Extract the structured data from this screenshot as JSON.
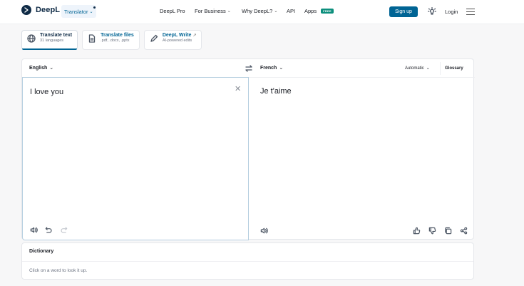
{
  "header": {
    "logo_text": "DeepL",
    "translator_label": "Translator",
    "nav": {
      "pro": "DeepL Pro",
      "business": "For Business",
      "why": "Why DeepL?",
      "api": "API",
      "apps": "Apps",
      "free_badge": "FREE"
    },
    "signup": "Sign up",
    "login": "Login"
  },
  "tabs": [
    {
      "label": "Translate text",
      "sub": "31 languages"
    },
    {
      "label": "Translate files",
      "sub": ".pdf, .docx, .pptx"
    },
    {
      "label": "DeepL Write",
      "sub": "AI-powered edits"
    }
  ],
  "translator": {
    "source_lang": "English",
    "target_lang": "French",
    "formality": "Automatic",
    "glossary": "Glossary",
    "source_text": "I love you",
    "target_text": "Je t'aime"
  },
  "dictionary": {
    "title": "Dictionary",
    "hint": "Click on a word to look it up."
  },
  "colors": {
    "brand_navy": "#0f2b46",
    "accent_blue": "#006494",
    "free_badge": "#0d8f7d"
  },
  "icons": [
    "deepl-logo-icon",
    "globe-icon",
    "file-icon",
    "pen-icon",
    "external-link-icon",
    "swap-icon",
    "lightbulb-icon",
    "menu-icon",
    "speaker-icon",
    "undo-icon",
    "redo-icon",
    "thumbs-up-icon",
    "thumbs-down-icon",
    "copy-icon",
    "share-icon",
    "close-icon"
  ]
}
